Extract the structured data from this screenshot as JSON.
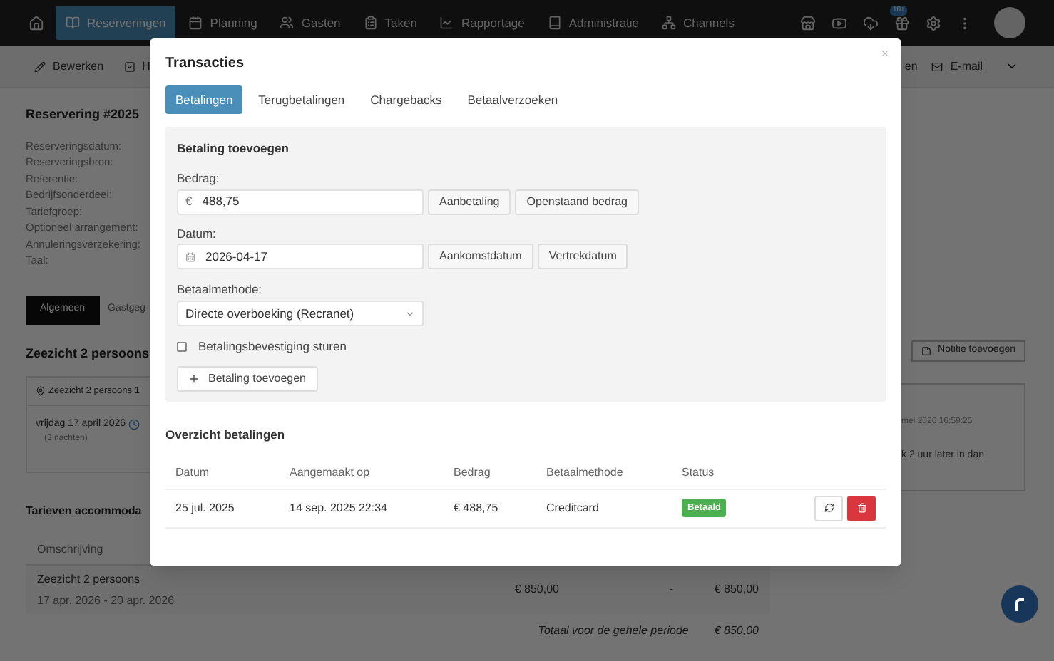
{
  "nav": {
    "items": [
      {
        "label": "Reserveringen",
        "selected": true
      },
      {
        "label": "Planning",
        "selected": false
      },
      {
        "label": "Gasten",
        "selected": false
      },
      {
        "label": "Taken",
        "selected": false
      },
      {
        "label": "Rapportage",
        "selected": false
      },
      {
        "label": "Administratie",
        "selected": false
      },
      {
        "label": "Channels",
        "selected": false
      }
    ],
    "badge": "10+"
  },
  "toolbar": {
    "left": [
      "Bewerken",
      "H"
    ],
    "right": [
      "en",
      "E-mail"
    ]
  },
  "reservation": {
    "title": "Reservering #2025",
    "fields": [
      "Reserveringsdatum:",
      "Reserveringsbron:",
      "Referentie:",
      "Bedrijfsonderdeel:",
      "Tariefgroep:",
      "Optioneel arrangement:",
      "Annuleringsverzekering:",
      "Taal:"
    ],
    "tabs": [
      {
        "label": "Algemeen",
        "selected": true
      },
      {
        "label": "Gastgeg",
        "selected": false
      }
    ],
    "accommodation": {
      "title": "Zeezicht 2 persoons",
      "location": "Zeezicht 2 persoons 1",
      "date": "vrijdag 17 april 2026",
      "nights": "(3 nachten)"
    },
    "note_button": "Notitie toevoegen",
    "note": {
      "timestamp": "mei 2026 16:59:25",
      "text": "k 2 uur later in dan"
    }
  },
  "rates": {
    "title": "Tarieven accommoda",
    "columns": [
      "Omschrijving"
    ],
    "rows": [
      {
        "description": "Zeezicht 2 persoons",
        "period": "17 apr. 2026 - 20 apr. 2026",
        "rate": "€ 850,00",
        "per_night": "-",
        "total": "€ 850,00"
      }
    ],
    "total_label": "Totaal voor de gehele periode",
    "total": "€ 850,00"
  },
  "modal": {
    "title": "Transacties",
    "tabs": [
      {
        "label": "Betalingen",
        "selected": true
      },
      {
        "label": "Terugbetalingen",
        "selected": false
      },
      {
        "label": "Chargebacks",
        "selected": false
      },
      {
        "label": "Betaalverzoeken",
        "selected": false
      }
    ],
    "form": {
      "title": "Betaling toevoegen",
      "amount": {
        "label": "Bedrag:",
        "prefix": "€",
        "value": "488,75",
        "buttons": [
          "Aanbetaling",
          "Openstaand bedrag"
        ]
      },
      "date": {
        "label": "Datum:",
        "value": "2026-04-17",
        "buttons": [
          "Aankomstdatum",
          "Vertrekdatum"
        ]
      },
      "method": {
        "label": "Betaalmethode:",
        "value": "Directe overboeking (Recranet)"
      },
      "confirmation": {
        "label": "Betalingsbevestiging sturen",
        "checked": false
      },
      "submit": "Betaling toevoegen"
    },
    "overview": {
      "title": "Overzicht betalingen",
      "columns": [
        "Datum",
        "Aangemaakt op",
        "Bedrag",
        "Betaalmethode",
        "Status"
      ],
      "rows": [
        {
          "date": "25 jul. 2025",
          "created": "14 sep. 2025 22:34",
          "amount": "€ 488,75",
          "method": "Creditcard",
          "status": "Betaald",
          "color": "#4caf50"
        }
      ]
    }
  }
}
